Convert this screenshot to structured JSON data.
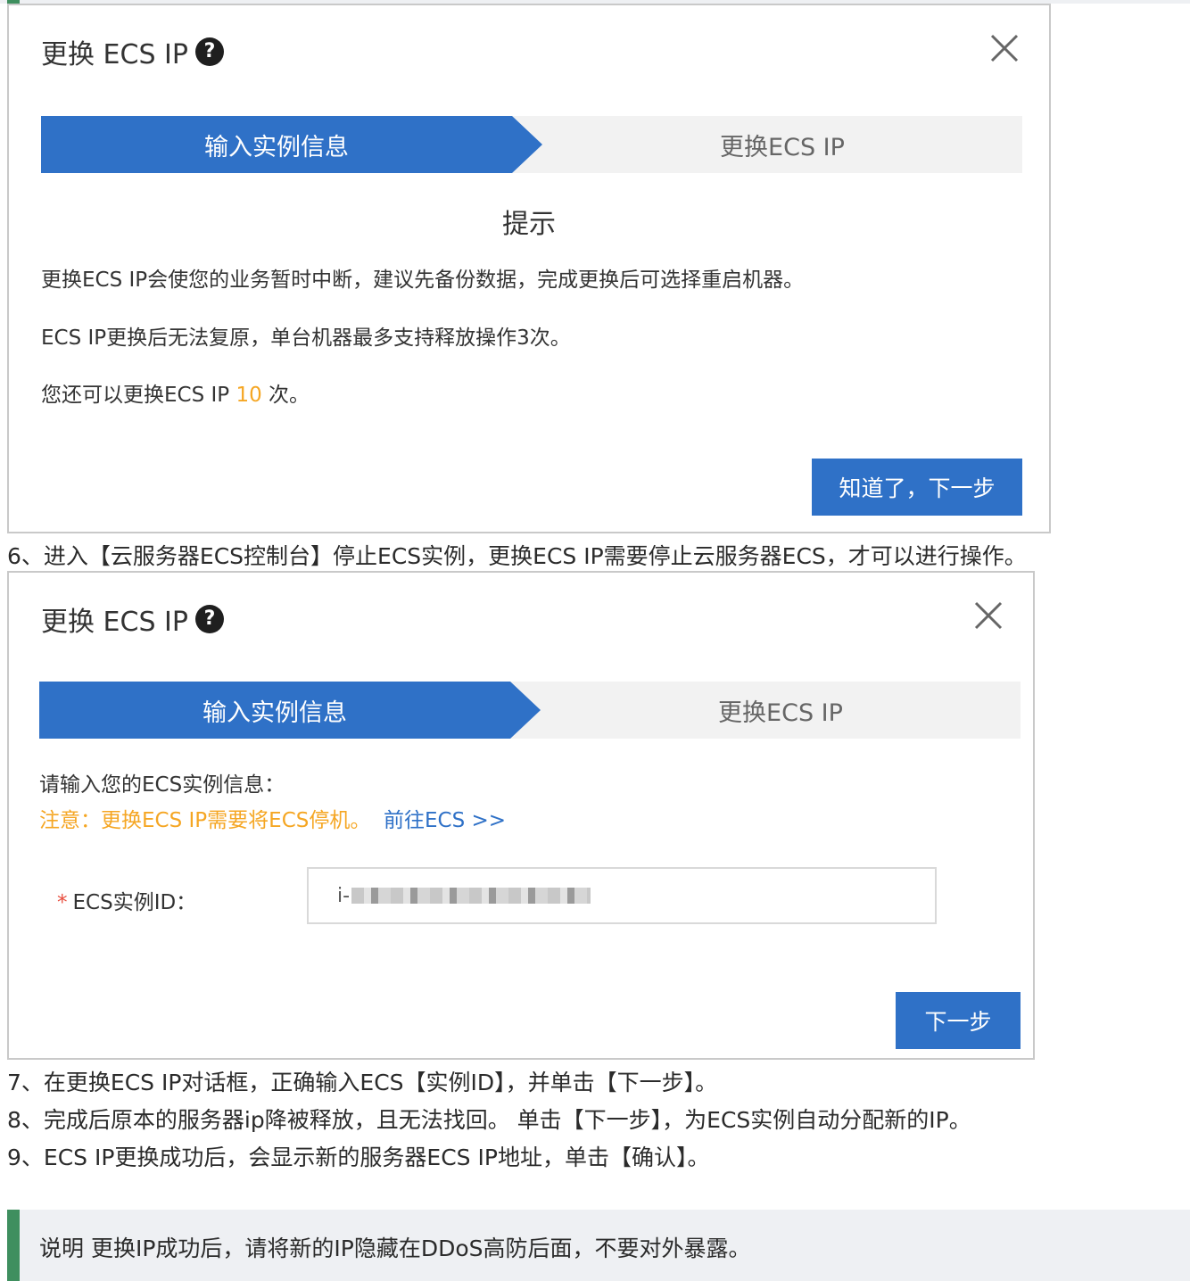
{
  "colors": {
    "primary": "#2f71c7",
    "warning": "#f5a623",
    "note_accent": "#3f8f5f"
  },
  "dialog1": {
    "title": "更换 ECS IP",
    "help_icon": "?",
    "close_icon": "close-icon",
    "step1": "输入实例信息",
    "step2": "更换ECS IP",
    "tip_title": "提示",
    "line1": "更换ECS IP会使您的业务暂时中断，建议先备份数据，完成更换后可选择重启机器。",
    "line2": "ECS IP更换后无法复原，单台机器最多支持释放操作3次。",
    "line3_prefix": "您还可以更换ECS IP ",
    "line3_count": "10",
    "line3_suffix": " 次。",
    "button": "知道了，下一步"
  },
  "step6": "6、进入【云服务器ECS控制台】停止ECS实例，更换ECS IP需要停止云服务器ECS，才可以进行操作。",
  "dialog2": {
    "title": "更换 ECS IP",
    "help_icon": "?",
    "step1": "输入实例信息",
    "step2": "更换ECS IP",
    "prompt": "请输入您的ECS实例信息：",
    "warning": "注意：更换ECS IP需要将ECS停机。",
    "link": "前往ECS >>",
    "field_required": "*",
    "field_label": "ECS实例ID：",
    "field_value_prefix": "i-",
    "button": "下一步"
  },
  "step7": "7、在更换ECS IP对话框，正确输入ECS【实例ID】，并单击【下一步】。",
  "step8": "8、完成后原本的服务器ip降被释放，且无法找回。 单击【下一步】，为ECS实例自动分配新的IP。",
  "step9": "9、ECS IP更换成功后，会显示新的服务器ECS IP地址，单击【确认】。",
  "note": "说明 更换IP成功后，请将新的IP隐藏在DDoS高防后面，不要对外暴露。"
}
